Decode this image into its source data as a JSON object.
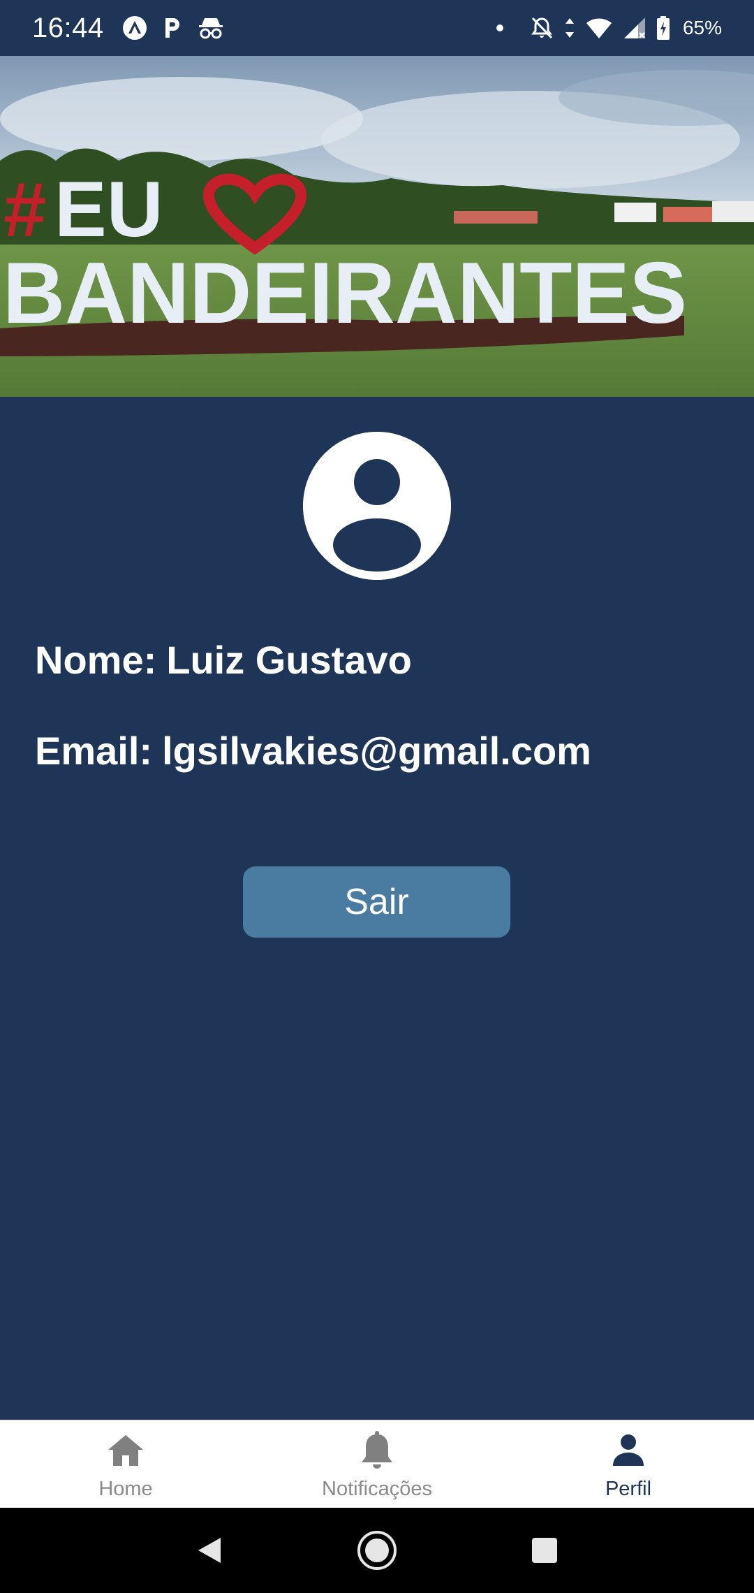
{
  "status_bar": {
    "time": "16:44",
    "battery": "65%",
    "left_icons": [
      "expo-icon",
      "parking-icon",
      "incognito-icon"
    ],
    "right_icons": [
      "dot-icon",
      "mute-icon",
      "data-arrows-icon",
      "wifi-icon",
      "signal-icon",
      "battery-icon"
    ]
  },
  "header": {
    "image_text": {
      "line1": "#EU",
      "line2": "BANDEIRANTES"
    }
  },
  "profile": {
    "name_label": "Nome:",
    "name_value": "Luiz Gustavo",
    "email_label": "Email:",
    "email_value": "lgsilvakies@gmail.com"
  },
  "actions": {
    "logout_label": "Sair"
  },
  "tabs": [
    {
      "label": "Home",
      "icon": "home-icon",
      "active": false
    },
    {
      "label": "Notificações",
      "icon": "bell-icon",
      "active": false
    },
    {
      "label": "Perfil",
      "icon": "person-icon",
      "active": true
    }
  ],
  "colors": {
    "background": "#1e3557",
    "button": "#4a7ba0",
    "tab_active": "#1e3557",
    "tab_inactive": "#8a8a8a"
  }
}
